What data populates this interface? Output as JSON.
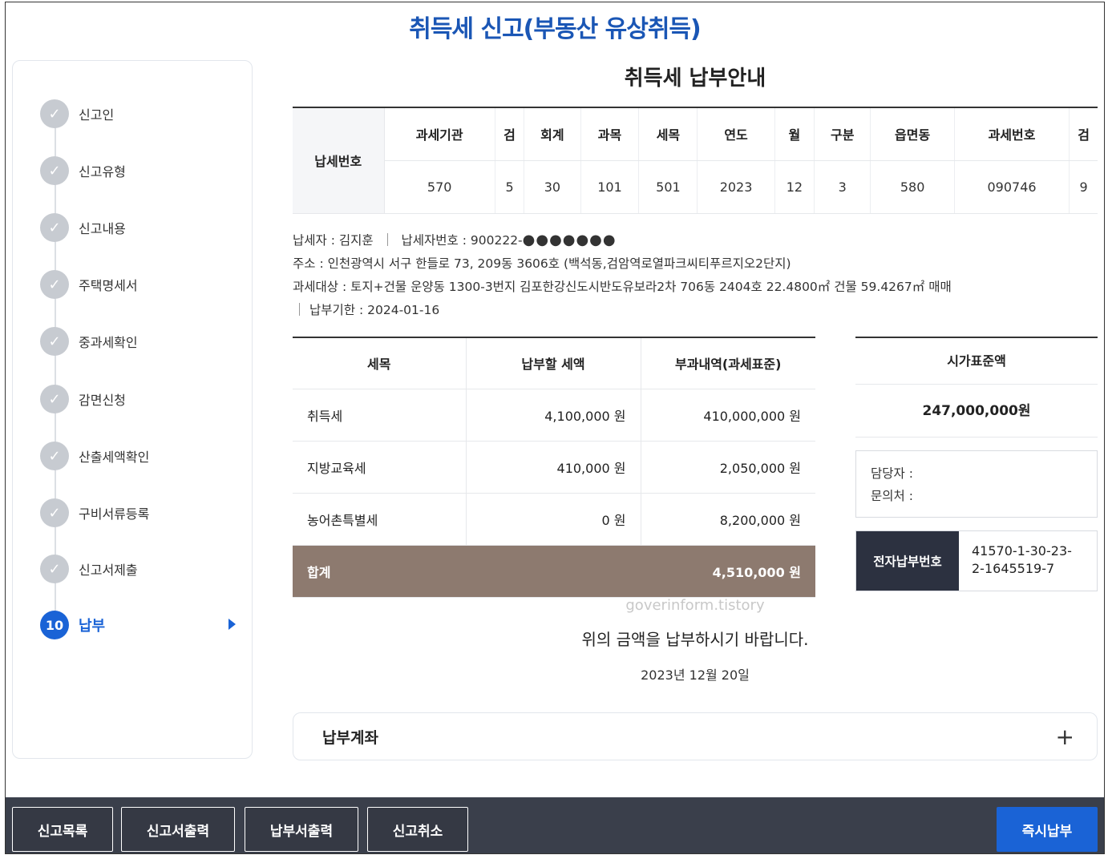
{
  "title": "취득세 신고(부동산 유상취득)",
  "sidebar": {
    "steps": [
      {
        "label": "신고인",
        "state": "done"
      },
      {
        "label": "신고유형",
        "state": "done"
      },
      {
        "label": "신고내용",
        "state": "done"
      },
      {
        "label": "주택명세서",
        "state": "done"
      },
      {
        "label": "중과세확인",
        "state": "done"
      },
      {
        "label": "감면신청",
        "state": "done"
      },
      {
        "label": "산출세액확인",
        "state": "done"
      },
      {
        "label": "구비서류등록",
        "state": "done"
      },
      {
        "label": "신고서제출",
        "state": "done"
      },
      {
        "label": "납부",
        "state": "active",
        "number": "10"
      }
    ]
  },
  "main": {
    "section_title": "취득세 납부안내",
    "tax_number": {
      "row_label": "납세번호",
      "headers": [
        "과세기관",
        "검",
        "회계",
        "과목",
        "세목",
        "연도",
        "월",
        "구분",
        "읍면동",
        "과세번호",
        "검"
      ],
      "values": [
        "570",
        "5",
        "30",
        "101",
        "501",
        "2023",
        "12",
        "3",
        "580",
        "090746",
        "9"
      ]
    },
    "info": {
      "taxpayer": "납세자 : 김지훈",
      "taxpayer_id_label": "납세자번호 : 900222-",
      "taxpayer_id_mask": "●●●●●●●",
      "address": "주소 : 인천광역시 서구 한들로 73, 209동 3606호 (백석동,검암역로열파크씨티푸르지오2단지)",
      "target": "과세대상 : 토지+건물 운양동 1300-3번지 김포한강신도시반도유보라2차 706동 2404호 22.4800㎡ 건물 59.4267㎡ 매매",
      "due_date": "납부기한 : 2024-01-16"
    },
    "calc": {
      "headers": [
        "세목",
        "납부할 세액",
        "부과내역(과세표준)"
      ],
      "rows": [
        {
          "item": "취득세",
          "tax": "4,100,000 원",
          "base": "410,000,000 원"
        },
        {
          "item": "지방교육세",
          "tax": "410,000 원",
          "base": "2,050,000 원"
        },
        {
          "item": "농어촌특별세",
          "tax": "0 원",
          "base": "8,200,000 원"
        }
      ],
      "total_label": "합계",
      "total_value": "4,510,000 원"
    },
    "standard_price": {
      "label": "시가표준액",
      "value": "247,000,000원"
    },
    "contact": {
      "manager": "담당자 :",
      "inquiry": "문의처 :"
    },
    "epay": {
      "label": "전자납부번호",
      "number": "41570-1-30-23-2-1645519-7"
    },
    "watermark": "goverinform.tistory",
    "notice": "위의 금액을 납부하시기 바랍니다.",
    "date": "2023년 12월 20일",
    "account_title": "납부계좌",
    "account_toggle": "+"
  },
  "footer": {
    "buttons": [
      "신고목록",
      "신고서출력",
      "납부서출력",
      "신고취소"
    ],
    "primary_button": "즉시납부"
  },
  "colors": {
    "accent": "#1a63d6",
    "title": "#1a56b5",
    "total_row": "#8d7a6f",
    "epay_label_bg": "#2c3140",
    "bottom_bar": "#3a3f4b"
  }
}
